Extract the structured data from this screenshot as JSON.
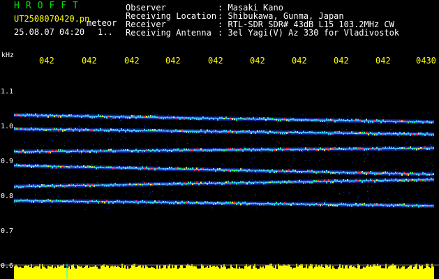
{
  "header": {
    "app_title": "HROFFT",
    "file_name": "UT2508070420.pn",
    "mode_label": "meteor",
    "date_time": "25.08.07 04:20",
    "count_label": "1..",
    "fields": [
      {
        "label": "Observer",
        "value": ": Masaki Kano"
      },
      {
        "label": "Receiving Location",
        "value": ": Shibukawa, Gunma, Japan"
      },
      {
        "label": "Receiver",
        "value": ": RTL-SDR SDR# 43dB L15 103.2MHz CW"
      },
      {
        "label": "Receiving Antenna",
        "value": ": 3el Yagi(V) Az 330 for Vladivostok"
      }
    ]
  },
  "colors": {
    "title": "#00e000",
    "label_white": "#ffffff",
    "label_yellow": "#ffff00",
    "bar_yellow": "#ffff00",
    "trace_cyan": "#00ffff"
  },
  "time_axis": {
    "ticks": [
      "042",
      "042",
      "042",
      "042",
      "042",
      "042",
      "042",
      "042",
      "042",
      "0430"
    ]
  },
  "freq_axis": {
    "unit": "kHz",
    "labels": [
      "1.1",
      "1.0",
      "0.9",
      "0.8",
      "0.7",
      "0.6"
    ]
  },
  "chart_data": {
    "type": "heatmap",
    "xlabel": "",
    "ylabel": "kHz",
    "ylim": [
      0.6,
      1.15
    ],
    "y_ticks": [
      1.1,
      1.0,
      0.9,
      0.8,
      0.7,
      0.6
    ],
    "traces": [
      {
        "y_start": 1.03,
        "y_end": 1.01,
        "intensity": 0.5
      },
      {
        "y_start": 0.99,
        "y_end": 0.975,
        "intensity": 0.55
      },
      {
        "y_start": 0.925,
        "y_end": 0.935,
        "intensity": 0.9
      },
      {
        "y_start": 0.885,
        "y_end": 0.86,
        "intensity": 0.85
      },
      {
        "y_start": 0.825,
        "y_end": 0.845,
        "intensity": 0.8
      },
      {
        "y_start": 0.785,
        "y_end": 0.77,
        "intensity": 0.55
      }
    ]
  }
}
